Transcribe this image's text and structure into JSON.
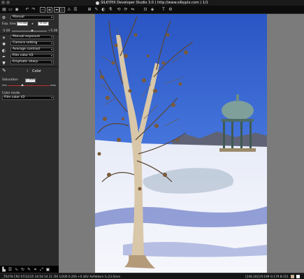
{
  "window": {
    "title": "SILKYPIX Developer Studio 3.0 ( http://www.silkypix.com )    1/1"
  },
  "toolbar": {
    "icons": [
      "open-icon",
      "folder-icon",
      "camera-icon",
      "undo-icon",
      "redo-icon",
      "view-single-icon",
      "view-grid-icon",
      "view-filmstrip-icon",
      "view-compare-icon",
      "warning-icon",
      "grid-icon",
      "eyedropper-icon",
      "wb-icon",
      "rotate-left-icon",
      "rotate-right-icon",
      "flip-icon",
      "crop-icon",
      "tone-icon",
      "text-icon",
      "gear-icon"
    ]
  },
  "panel": {
    "preset": {
      "value": "Manual"
    },
    "exposure": {
      "label": "Exp. bias",
      "value": "+0.82",
      "step": "0.52",
      "min": "-5.00",
      "max": "+5.00"
    },
    "controls": [
      {
        "name": "exposure-mode",
        "value": "Manual exposure"
      },
      {
        "name": "camera-setting",
        "value": "Camera setting"
      },
      {
        "name": "contrast",
        "value": "Average contrast"
      },
      {
        "name": "film-color",
        "value": "Film color V2"
      },
      {
        "name": "sharpness",
        "value": "Emphatic sharp."
      }
    ],
    "color_tab": {
      "label": "Color"
    },
    "saturation": {
      "label": "Saturation",
      "value": "1.000",
      "min": "min",
      "max": "max"
    },
    "color_mode": {
      "label": "Color mode",
      "value": "Film color V2"
    }
  },
  "status": {
    "left": "_T0279.CR2 07/12/15 14:54:14.11 /50  1/200 0.20S +0.3EV AvPattern f=23.0mm",
    "right": "[246,162]:R:199 G:179 B:151"
  },
  "colors": {
    "accent": "#c03030",
    "panel": "#2b2b2b",
    "sky": "#3f6bd0"
  }
}
